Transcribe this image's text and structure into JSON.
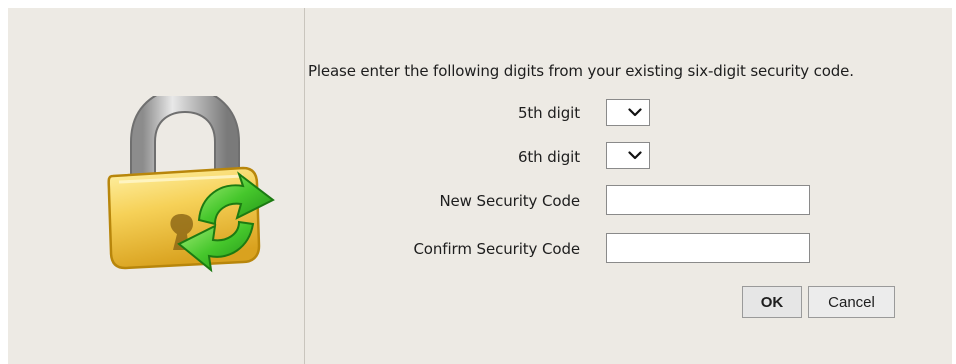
{
  "dialog": {
    "instruction": "Please enter the following digits from your existing six-digit security code."
  },
  "form": {
    "digit5": {
      "label": "5th digit",
      "value": ""
    },
    "digit6": {
      "label": "6th digit",
      "value": ""
    },
    "new_code": {
      "label": "New Security Code",
      "value": "",
      "placeholder": ""
    },
    "confirm_code": {
      "label": "Confirm Security Code",
      "value": "",
      "placeholder": ""
    }
  },
  "buttons": {
    "ok_label": "OK",
    "cancel_label": "Cancel"
  },
  "icons": {
    "main": "lock-refresh-icon",
    "dropdown": "chevron-down-icon"
  },
  "colors": {
    "background": "#edeae4",
    "lock_body": "#f2c94c",
    "lock_shackle": "#b5b5b5",
    "arrows": "#3fbf2a"
  }
}
